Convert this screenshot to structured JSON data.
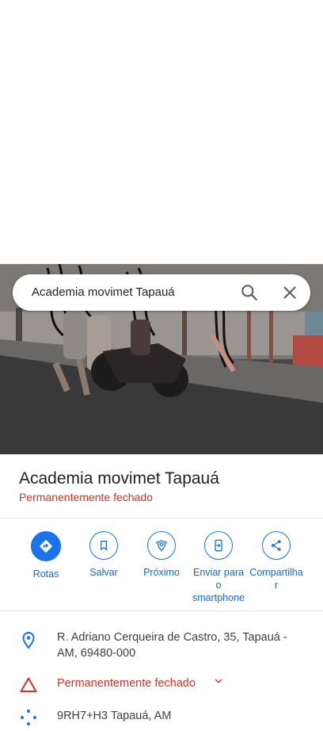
{
  "search": {
    "query": "Academia movimet Tapauá"
  },
  "place": {
    "name": "Academia movimet Tapauá",
    "status": "Permanentemente fechado"
  },
  "actions": [
    {
      "label": "Rotas",
      "icon": "directions-icon"
    },
    {
      "label": "Salvar",
      "icon": "bookmark-icon"
    },
    {
      "label": "Próximo",
      "icon": "nearby-icon"
    },
    {
      "label": "Enviar para o smartphone",
      "label_lines": [
        "Enviar para",
        "o",
        "smartphone"
      ],
      "icon": "send-to-phone-icon"
    },
    {
      "label": "Compartilhar",
      "label_lines": [
        "Compartilha",
        "r"
      ],
      "icon": "share-icon"
    }
  ],
  "details": {
    "address_lines": [
      "R. Adriano Cerqueira de Castro, 35, Tapauá -",
      "AM, 69480-000"
    ],
    "status": "Permanentemente fechado",
    "plus_code": "9RH7+H3 Tapauá, AM"
  },
  "colors": {
    "accent": "#1a73e8",
    "status_red": "#d93025"
  }
}
